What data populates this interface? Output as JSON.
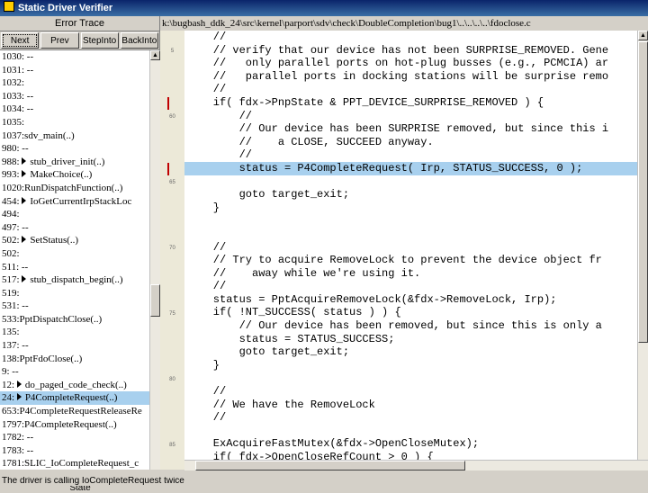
{
  "window": {
    "title": "Static Driver Verifier"
  },
  "left_panel": {
    "header": "Error Trace",
    "buttons": [
      "Next",
      "Prev",
      "StepInto",
      "BackInto"
    ],
    "rows": [
      {
        "text": "1030: --",
        "marker": false,
        "selected": false
      },
      {
        "text": "1031: --",
        "marker": false,
        "selected": false
      },
      {
        "text": "1032:",
        "marker": false,
        "selected": false
      },
      {
        "text": "1033: --",
        "marker": false,
        "selected": false
      },
      {
        "text": "1034: --",
        "marker": false,
        "selected": false
      },
      {
        "text": "1035:",
        "marker": false,
        "selected": false
      },
      {
        "text": "1037:sdv_main(..)",
        "marker": false,
        "selected": false
      },
      {
        "text": "980: --",
        "marker": false,
        "selected": false
      },
      {
        "text": "988:",
        "marker": true,
        "marker_text": "stub_driver_init(..)",
        "selected": false
      },
      {
        "text": "993:",
        "marker": true,
        "marker_text": "MakeChoice(..)",
        "selected": false
      },
      {
        "text": "1020:RunDispatchFunction(..)",
        "marker": false,
        "selected": false
      },
      {
        "text": "454:",
        "marker": true,
        "marker_text": "IoGetCurrentIrpStackLoc",
        "selected": false
      },
      {
        "text": "494:",
        "marker": false,
        "selected": false
      },
      {
        "text": "497: --",
        "marker": false,
        "selected": false
      },
      {
        "text": "502:",
        "marker": true,
        "marker_text": "SetStatus(..)",
        "selected": false
      },
      {
        "text": "502:",
        "marker": false,
        "selected": false
      },
      {
        "text": "511: --",
        "marker": false,
        "selected": false
      },
      {
        "text": "517:",
        "marker": true,
        "marker_text": "stub_dispatch_begin(..)",
        "selected": false
      },
      {
        "text": "519:",
        "marker": false,
        "selected": false
      },
      {
        "text": "531: --",
        "marker": false,
        "selected": false
      },
      {
        "text": "533:PptDispatchClose(..)",
        "marker": false,
        "selected": false
      },
      {
        "text": "135:",
        "marker": false,
        "selected": false
      },
      {
        "text": "137: --",
        "marker": false,
        "selected": false
      },
      {
        "text": "138:PptFdoClose(..)",
        "marker": false,
        "selected": false
      },
      {
        "text": "9: --",
        "marker": false,
        "selected": false
      },
      {
        "text": "12:",
        "marker": true,
        "marker_text": "do_paged_code_check(..)",
        "selected": false
      },
      {
        "text": "24:",
        "marker": true,
        "marker_text": "P4CompleteRequest(..)",
        "selected": true
      },
      {
        "text": "653:P4CompleteRequestReleaseRe",
        "marker": false,
        "selected": false
      },
      {
        "text": "1797:P4CompleteRequest(..)",
        "marker": false,
        "selected": false
      },
      {
        "text": "1782: --",
        "marker": false,
        "selected": false
      },
      {
        "text": "1783: --",
        "marker": false,
        "selected": false
      },
      {
        "text": "1781:SLIC_IoCompleteRequest_c",
        "marker": false,
        "selected": false
      }
    ],
    "state_label": "State"
  },
  "editor": {
    "path": "k:\\bugbash_ddk_24\\src\\kernel\\parport\\sdv\\check\\DoubleCompletion\\bug1\\..\\..\\..\\..\\fdoclose.c",
    "lines": [
      {
        "text": "    //",
        "highlight": false
      },
      {
        "text": "    // verify that our device has not been SURPRISE_REMOVED. Gene",
        "highlight": false
      },
      {
        "text": "    //   only parallel ports on hot-plug busses (e.g., PCMCIA) ar",
        "highlight": false
      },
      {
        "text": "    //   parallel ports in docking stations will be surprise remo",
        "highlight": false
      },
      {
        "text": "    //",
        "highlight": false
      },
      {
        "text": "    if( fdx->PnpState & PPT_DEVICE_SURPRISE_REMOVED ) {",
        "highlight": false
      },
      {
        "text": "        //",
        "highlight": false
      },
      {
        "text": "        // Our device has been SURPRISE removed, but since this i",
        "highlight": false
      },
      {
        "text": "        //    a CLOSE, SUCCEED anyway.",
        "highlight": false
      },
      {
        "text": "        //",
        "highlight": false
      },
      {
        "text": "        status = P4CompleteRequest( Irp, STATUS_SUCCESS, 0 );",
        "highlight": true
      },
      {
        "text": "",
        "highlight": false
      },
      {
        "text": "        goto target_exit;",
        "highlight": false
      },
      {
        "text": "    }",
        "highlight": false
      },
      {
        "text": "",
        "highlight": false
      },
      {
        "text": "",
        "highlight": false
      },
      {
        "text": "    //",
        "highlight": false
      },
      {
        "text": "    // Try to acquire RemoveLock to prevent the device object fr",
        "highlight": false
      },
      {
        "text": "    //    away while we're using it.",
        "highlight": false
      },
      {
        "text": "    //",
        "highlight": false
      },
      {
        "text": "    status = PptAcquireRemoveLock(&fdx->RemoveLock, Irp);",
        "highlight": false
      },
      {
        "text": "    if( !NT_SUCCESS( status ) ) {",
        "highlight": false
      },
      {
        "text": "        // Our device has been removed, but since this is only a",
        "highlight": false
      },
      {
        "text": "        status = STATUS_SUCCESS;",
        "highlight": false
      },
      {
        "text": "        goto target_exit;",
        "highlight": false
      },
      {
        "text": "    }",
        "highlight": false
      },
      {
        "text": "",
        "highlight": false
      },
      {
        "text": "    //",
        "highlight": false
      },
      {
        "text": "    // We have the RemoveLock",
        "highlight": false
      },
      {
        "text": "    //",
        "highlight": false
      },
      {
        "text": "",
        "highlight": false
      },
      {
        "text": "    ExAcquireFastMutex(&fdx->OpenCloseMutex);",
        "highlight": false
      },
      {
        "text": "    if( fdx->OpenCloseRefCount > 0 ) {",
        "highlight": false
      }
    ],
    "gutter_numbers": [
      {
        "line": 1,
        "text": "5"
      },
      {
        "line": 6,
        "text": "60"
      },
      {
        "line": 11,
        "text": "65"
      },
      {
        "line": 16,
        "text": "70"
      },
      {
        "line": 21,
        "text": "75"
      },
      {
        "line": 26,
        "text": "80"
      },
      {
        "line": 31,
        "text": "85"
      }
    ],
    "markers": [
      5,
      10
    ]
  },
  "statusbar": {
    "text": "The driver is calling IoCompleteRequest twice"
  }
}
